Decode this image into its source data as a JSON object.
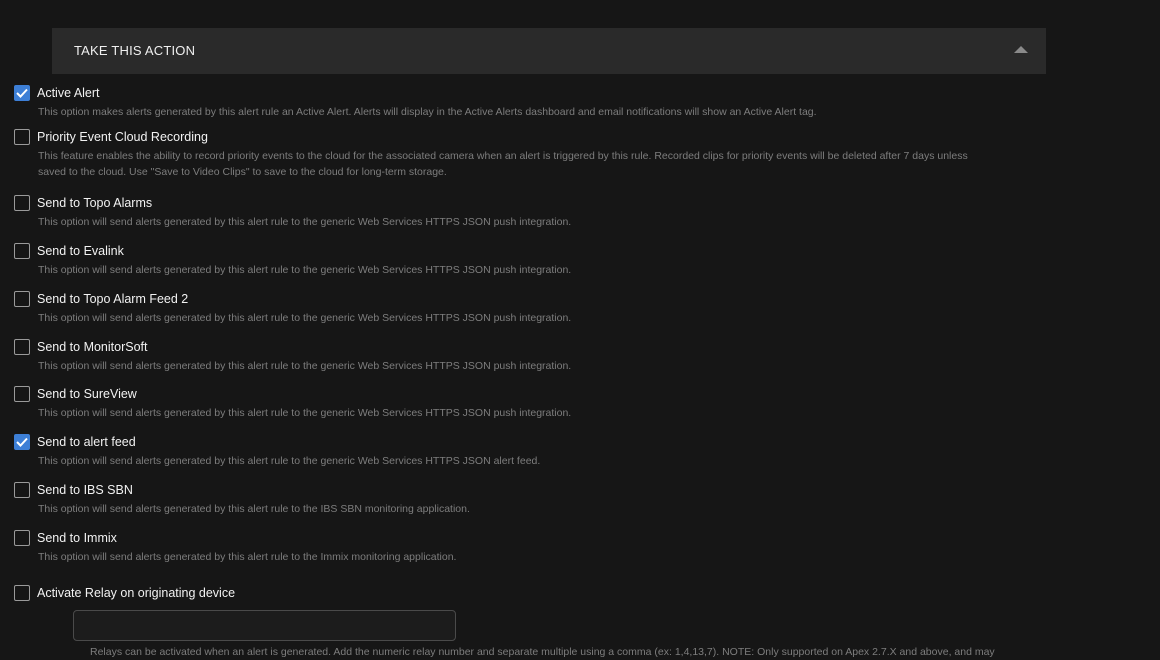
{
  "section": {
    "title": "TAKE THIS ACTION"
  },
  "options": [
    {
      "label": "Active Alert",
      "checked": true,
      "description": "This option makes alerts generated by this alert rule an Active Alert. Alerts will display in the Active Alerts dashboard and email notifications will show an Active Alert tag."
    },
    {
      "label": "Priority Event Cloud Recording",
      "checked": false,
      "description": "This feature enables the ability to record priority events to the cloud for the associated camera when an alert is triggered by this rule. Recorded clips for priority events will be deleted after 7 days unless saved to the cloud. Use \"Save to Video Clips\" to save to the cloud for long-term storage."
    },
    {
      "label": "Send to Topo Alarms",
      "checked": false,
      "description": "This option will send alerts generated by this alert rule to the generic Web Services HTTPS JSON push integration."
    },
    {
      "label": "Send to Evalink",
      "checked": false,
      "description": "This option will send alerts generated by this alert rule to the generic Web Services HTTPS JSON push integration."
    },
    {
      "label": "Send to Topo Alarm Feed 2",
      "checked": false,
      "description": "This option will send alerts generated by this alert rule to the generic Web Services HTTPS JSON push integration."
    },
    {
      "label": "Send to MonitorSoft",
      "checked": false,
      "description": "This option will send alerts generated by this alert rule to the generic Web Services HTTPS JSON push integration."
    },
    {
      "label": "Send to SureView",
      "checked": false,
      "description": "This option will send alerts generated by this alert rule to the generic Web Services HTTPS JSON push integration."
    },
    {
      "label": "Send to alert feed",
      "checked": true,
      "description": "This option will send alerts generated by this alert rule to the generic Web Services HTTPS JSON alert feed."
    },
    {
      "label": "Send to IBS SBN",
      "checked": false,
      "description": "This option will send alerts generated by this alert rule to the IBS SBN monitoring application."
    },
    {
      "label": "Send to Immix",
      "checked": false,
      "description": "This option will send alerts generated by this alert rule to the Immix monitoring application."
    },
    {
      "label": "Activate Relay on originating device",
      "checked": false,
      "description": ""
    }
  ],
  "relay": {
    "value": "",
    "description": "Relays can be activated when an alert is generated. Add the numeric relay number and separate multiple using a comma (ex: 1,4,13,7). NOTE: Only supported on Apex 2.7.X and above, and may"
  },
  "colors": {
    "accent": "#3d7fd6",
    "background": "#161616",
    "header": "#2a2a2a"
  }
}
